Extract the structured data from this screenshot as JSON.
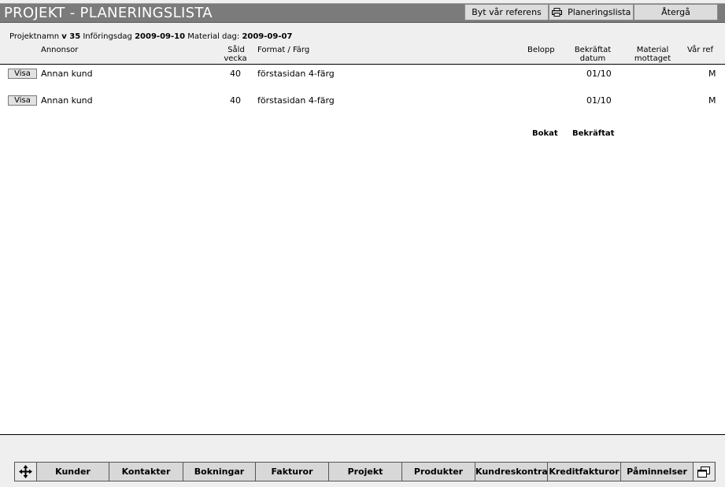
{
  "header": {
    "title": "PROJEKT - PLANERINGSLISTA",
    "buttons": {
      "swap_ref": "Byt vår referens",
      "planning_list": "Planeringslista",
      "back": "Återgå"
    }
  },
  "info": {
    "project_label": "Projektnamn",
    "project_value": "v 35",
    "insertion_label": "Införingsdag",
    "insertion_value": "2009-09-10",
    "material_label": "Material dag:",
    "material_value": "2009-09-07"
  },
  "columns": {
    "advertiser": "Annonsor",
    "sold_week_1": "Såld",
    "sold_week_2": "vecka",
    "format": "Format / Färg",
    "amount": "Belopp",
    "confirmed_1": "Bekräftat",
    "confirmed_2": "datum",
    "material_1": "Material",
    "material_2": "mottaget",
    "our_ref": "Vår ref"
  },
  "rows": [
    {
      "button": "Visa",
      "advertiser": "Annan kund",
      "week": "40",
      "format": "förstasidan 4-färg",
      "amount": "",
      "confirmed": "01/10",
      "material": "",
      "ref": "M"
    },
    {
      "button": "Visa",
      "advertiser": "Annan kund",
      "week": "40",
      "format": "förstasidan 4-färg",
      "amount": "",
      "confirmed": "01/10",
      "material": "",
      "ref": "M"
    }
  ],
  "footer": {
    "booked": "Bokat",
    "confirmed": "Bekräftat"
  },
  "nav": {
    "items": [
      "Kunder",
      "Kontakter",
      "Bokningar",
      "Fakturor",
      "Projekt",
      "Produkter",
      "Kundreskontra",
      "Kreditfakturor",
      "Påminnelser"
    ],
    "icons": [
      "move-icon",
      "window-icon"
    ]
  }
}
